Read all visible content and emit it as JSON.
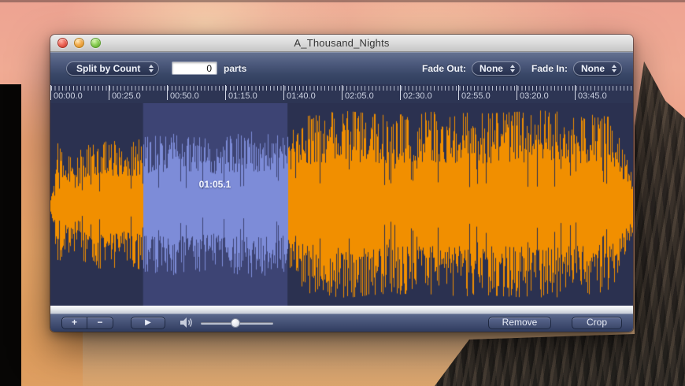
{
  "window_title": "A_Thousand_Nights",
  "toolbar": {
    "split_mode": "Split by Count",
    "parts_value": "0",
    "parts_label": "parts",
    "fade_out_label": "Fade Out:",
    "fade_out_value": "None",
    "fade_in_label": "Fade In:",
    "fade_in_value": "None"
  },
  "ruler": {
    "labels": [
      "00:00.0",
      "00:25.0",
      "00:50.0",
      "01:15.0",
      "01:40.0",
      "02:05.0",
      "02:30.0",
      "02:55.0",
      "03:20.0",
      "03:45.0"
    ]
  },
  "waveform": {
    "selection_label": "01:05.1",
    "selection_start": 0.159,
    "selection_end": 0.407,
    "colors": {
      "background": "#2b3150",
      "wave": "#f18f00",
      "selection_background": "#3d4474",
      "selection_wave": "#7d8cd8"
    },
    "envelope": [
      [
        0,
        0.08
      ],
      [
        0.012,
        0.62
      ],
      [
        0.025,
        0.45
      ],
      [
        0.05,
        0.6
      ],
      [
        0.09,
        0.68
      ],
      [
        0.13,
        0.6
      ],
      [
        0.16,
        0.68
      ],
      [
        0.22,
        0.72
      ],
      [
        0.28,
        0.65
      ],
      [
        0.34,
        0.74
      ],
      [
        0.4,
        0.7
      ],
      [
        0.425,
        0.88
      ],
      [
        0.5,
        0.95
      ],
      [
        0.58,
        0.9
      ],
      [
        0.66,
        0.94
      ],
      [
        0.75,
        0.92
      ],
      [
        0.84,
        0.95
      ],
      [
        0.92,
        0.92
      ],
      [
        0.965,
        0.88
      ],
      [
        0.982,
        0.55
      ],
      [
        1,
        0.3
      ]
    ]
  },
  "bottom_bar": {
    "zoom_in_label": "+",
    "zoom_out_label": "−",
    "play_icon": "▶",
    "volume_percent": 48,
    "remove_label": "Remove",
    "crop_label": "Crop"
  }
}
